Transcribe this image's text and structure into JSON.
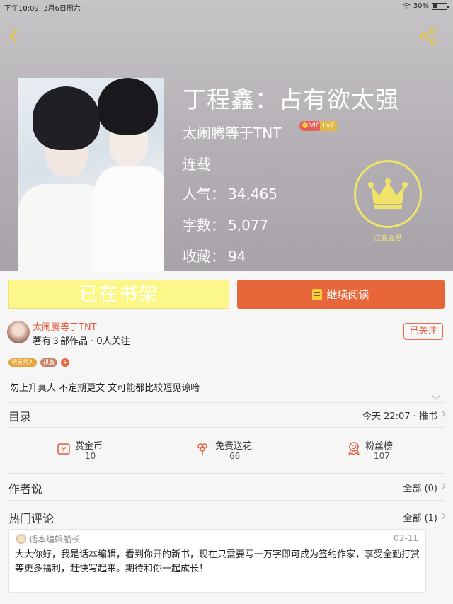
{
  "status_bar": {
    "time": "下午10:09",
    "date": "3月6日周六",
    "battery": "30%",
    "battery_level": 0.3
  },
  "book": {
    "title": "丁程鑫：占有欲太强",
    "author": "太闹腾等于TNT",
    "vip_badge": "VIP",
    "level_badge": "Lv2",
    "status": "连载",
    "popularity_label": "人气：",
    "popularity": "34,465",
    "words_label": "字数：",
    "words": "5,077",
    "favorites_label": "收藏：",
    "favorites": "94"
  },
  "member": {
    "label": "点亮会员"
  },
  "buttons": {
    "shelf": "已在书架",
    "continue": "继续阅读"
  },
  "author_card": {
    "name": "太闹腾等于TNT",
    "works": "著有３部作品 · 0人关注",
    "follow": "已关注"
  },
  "tags": [
    "明星同人",
    "祺鑫",
    "+"
  ],
  "description": "勿上升真人 不定期更文 文可能都比较短见谅哈",
  "catalog": {
    "label": "目录",
    "update": "今天 22:07 · 推书"
  },
  "stats": [
    {
      "name": "赏金币",
      "value": "10"
    },
    {
      "name": "免费送花",
      "value": "66"
    },
    {
      "name": "粉丝榜",
      "value": "107"
    }
  ],
  "author_says": {
    "label": "作者说",
    "count": "全部 (0)"
  },
  "hot_comments": {
    "label": "热门评论",
    "count": "全部 (1)"
  },
  "comment": {
    "user": "话本编辑船长",
    "date": "02-11",
    "text": "大大你好，我是话本编辑，看到你开的新书，现在只需要写一万字即可成为签约作家，享受全勤打赏等更多福利，赶快写起来。期待和你一起成长！"
  },
  "colors": {
    "accent": "#e8673a",
    "shelf_bg": "#fbf789",
    "crown": "#f0e46b"
  }
}
